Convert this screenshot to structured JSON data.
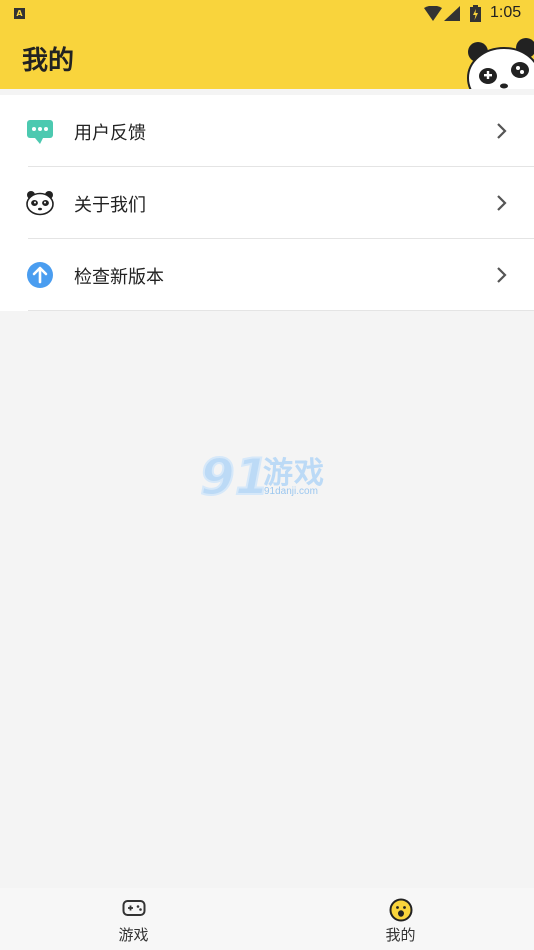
{
  "status_bar": {
    "app_badge": "A",
    "time": "1:05"
  },
  "header": {
    "title": "我的"
  },
  "menu": {
    "items": [
      {
        "label": "用户反馈",
        "icon": "feedback-chat-icon"
      },
      {
        "label": "关于我们",
        "icon": "panda-icon"
      },
      {
        "label": "检查新版本",
        "icon": "upgrade-arrow-icon"
      }
    ]
  },
  "watermark": {
    "brand": "游戏",
    "site": "91danji.com"
  },
  "tabbar": {
    "tabs": [
      {
        "label": "游戏",
        "icon": "gamepad-icon"
      },
      {
        "label": "我的",
        "icon": "smiley-face-icon"
      }
    ]
  },
  "colors": {
    "accent": "#f9d43c",
    "feedback": "#4cc9b0",
    "upgrade": "#4a9df0"
  }
}
